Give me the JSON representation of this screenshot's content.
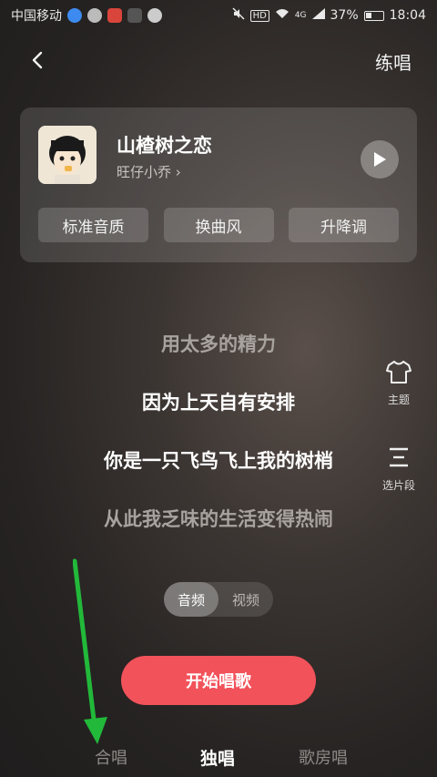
{
  "status_bar": {
    "carrier": "中国移动",
    "network": "4G",
    "battery": "37%",
    "time": "18:04"
  },
  "header": {
    "practice_label": "练唱"
  },
  "song": {
    "title": "山楂树之恋",
    "artist": "旺仔小乔 ›",
    "options": [
      "标准音质",
      "换曲风",
      "升降调"
    ]
  },
  "lyrics": [
    "用太多的精力",
    "因为上天自有安排",
    "你是一只飞鸟飞上我的树梢",
    "从此我乏味的生活变得热闹"
  ],
  "side_tools": {
    "theme_label": "主题",
    "segment_label": "选片段"
  },
  "mode_toggle": {
    "audio_label": "音频",
    "video_label": "视频",
    "selected": "音频"
  },
  "start_button": {
    "label": "开始唱歌"
  },
  "tabs": {
    "chorus": "合唱",
    "solo": "独唱",
    "room": "歌房唱",
    "active": "独唱"
  },
  "colors": {
    "accent": "#f2525a",
    "annotation_arrow": "#22b83a"
  }
}
